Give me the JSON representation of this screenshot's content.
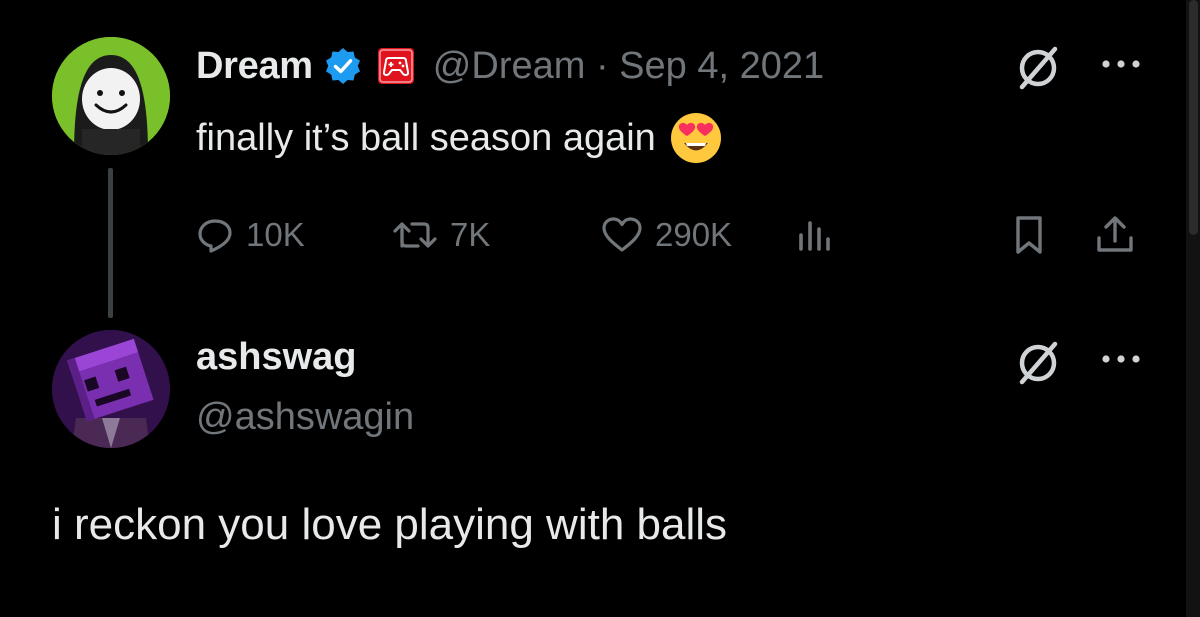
{
  "parent_tweet": {
    "display_name": "Dream",
    "verified_icon": "verified-badge-icon",
    "affiliate_icon": "gamepad-affiliate-icon",
    "handle_time": "@Dream · Sep 4, 2021",
    "text": "finally it’s ball season again",
    "emoji": "heart-eyes-emoji",
    "stats": {
      "replies": "10K",
      "retweets": "7K",
      "likes": "290K"
    }
  },
  "reply_tweet": {
    "display_name": "ashswag",
    "handle": "@ashswagin",
    "text": "i reckon you love playing with balls"
  },
  "colors": {
    "background": "#000000",
    "primary_text": "#e7e9ea",
    "secondary_text": "#71767b",
    "verified_blue": "#1d9bf0",
    "affiliate_red": "#e0141e",
    "dream_avatar_green": "#7ac02a"
  }
}
